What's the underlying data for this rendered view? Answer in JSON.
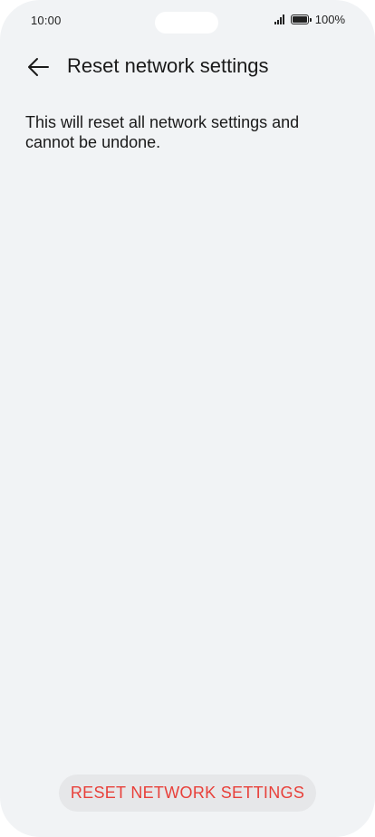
{
  "status_bar": {
    "time": "10:00",
    "battery_percent": "100%",
    "signal_icon": "signal-bars-icon",
    "battery_icon": "battery-full-icon"
  },
  "header": {
    "back_icon": "arrow-left-icon",
    "title": "Reset network settings"
  },
  "content": {
    "description": "This will reset all network settings and cannot be undone."
  },
  "actions": {
    "reset_label": "RESET NETWORK SETTINGS"
  },
  "colors": {
    "background": "#f1f3f5",
    "danger": "#e8403a",
    "button_bg": "#e6e7e9"
  }
}
